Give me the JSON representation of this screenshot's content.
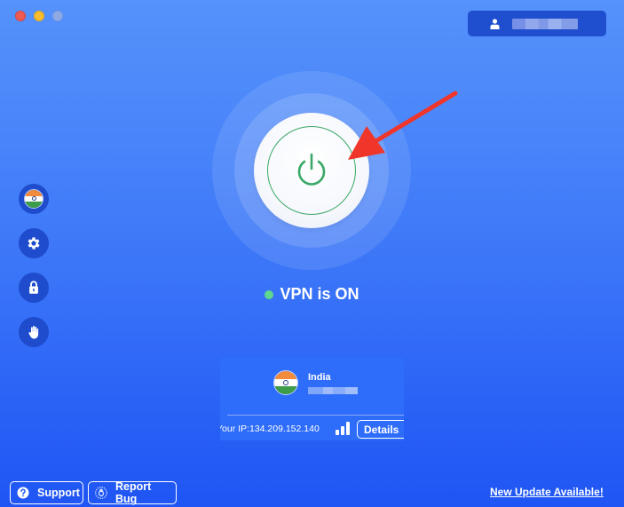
{
  "window": {
    "traffic_lights": [
      "close",
      "minimize",
      "maximize"
    ]
  },
  "account": {
    "icon": "user-icon",
    "username": "[blurred]"
  },
  "sidebar": {
    "items": [
      {
        "name": "location",
        "icon": "india-flag-icon"
      },
      {
        "name": "settings",
        "icon": "gear-icon"
      },
      {
        "name": "security",
        "icon": "lock-icon"
      },
      {
        "name": "block",
        "icon": "hand-icon"
      }
    ]
  },
  "power": {
    "icon": "power-icon",
    "state": "on",
    "color": "#3aa866"
  },
  "annotation": {
    "icon": "red-arrow-icon",
    "color": "#f0362a"
  },
  "status": {
    "label": "VPN is ON",
    "dot_color": "#5fd88d"
  },
  "location_card": {
    "country": "India",
    "server": "[blurred]",
    "ip_label": "Your IP:",
    "ip_value": "134.209.152.140",
    "ip_text": "Your IP:134.209.152.140",
    "signal_icon": "signal-bars-icon",
    "details_label": "Details"
  },
  "footer": {
    "support_label": "Support",
    "report_bug_label": "Report Bug",
    "update_link": "New Update Available!"
  }
}
